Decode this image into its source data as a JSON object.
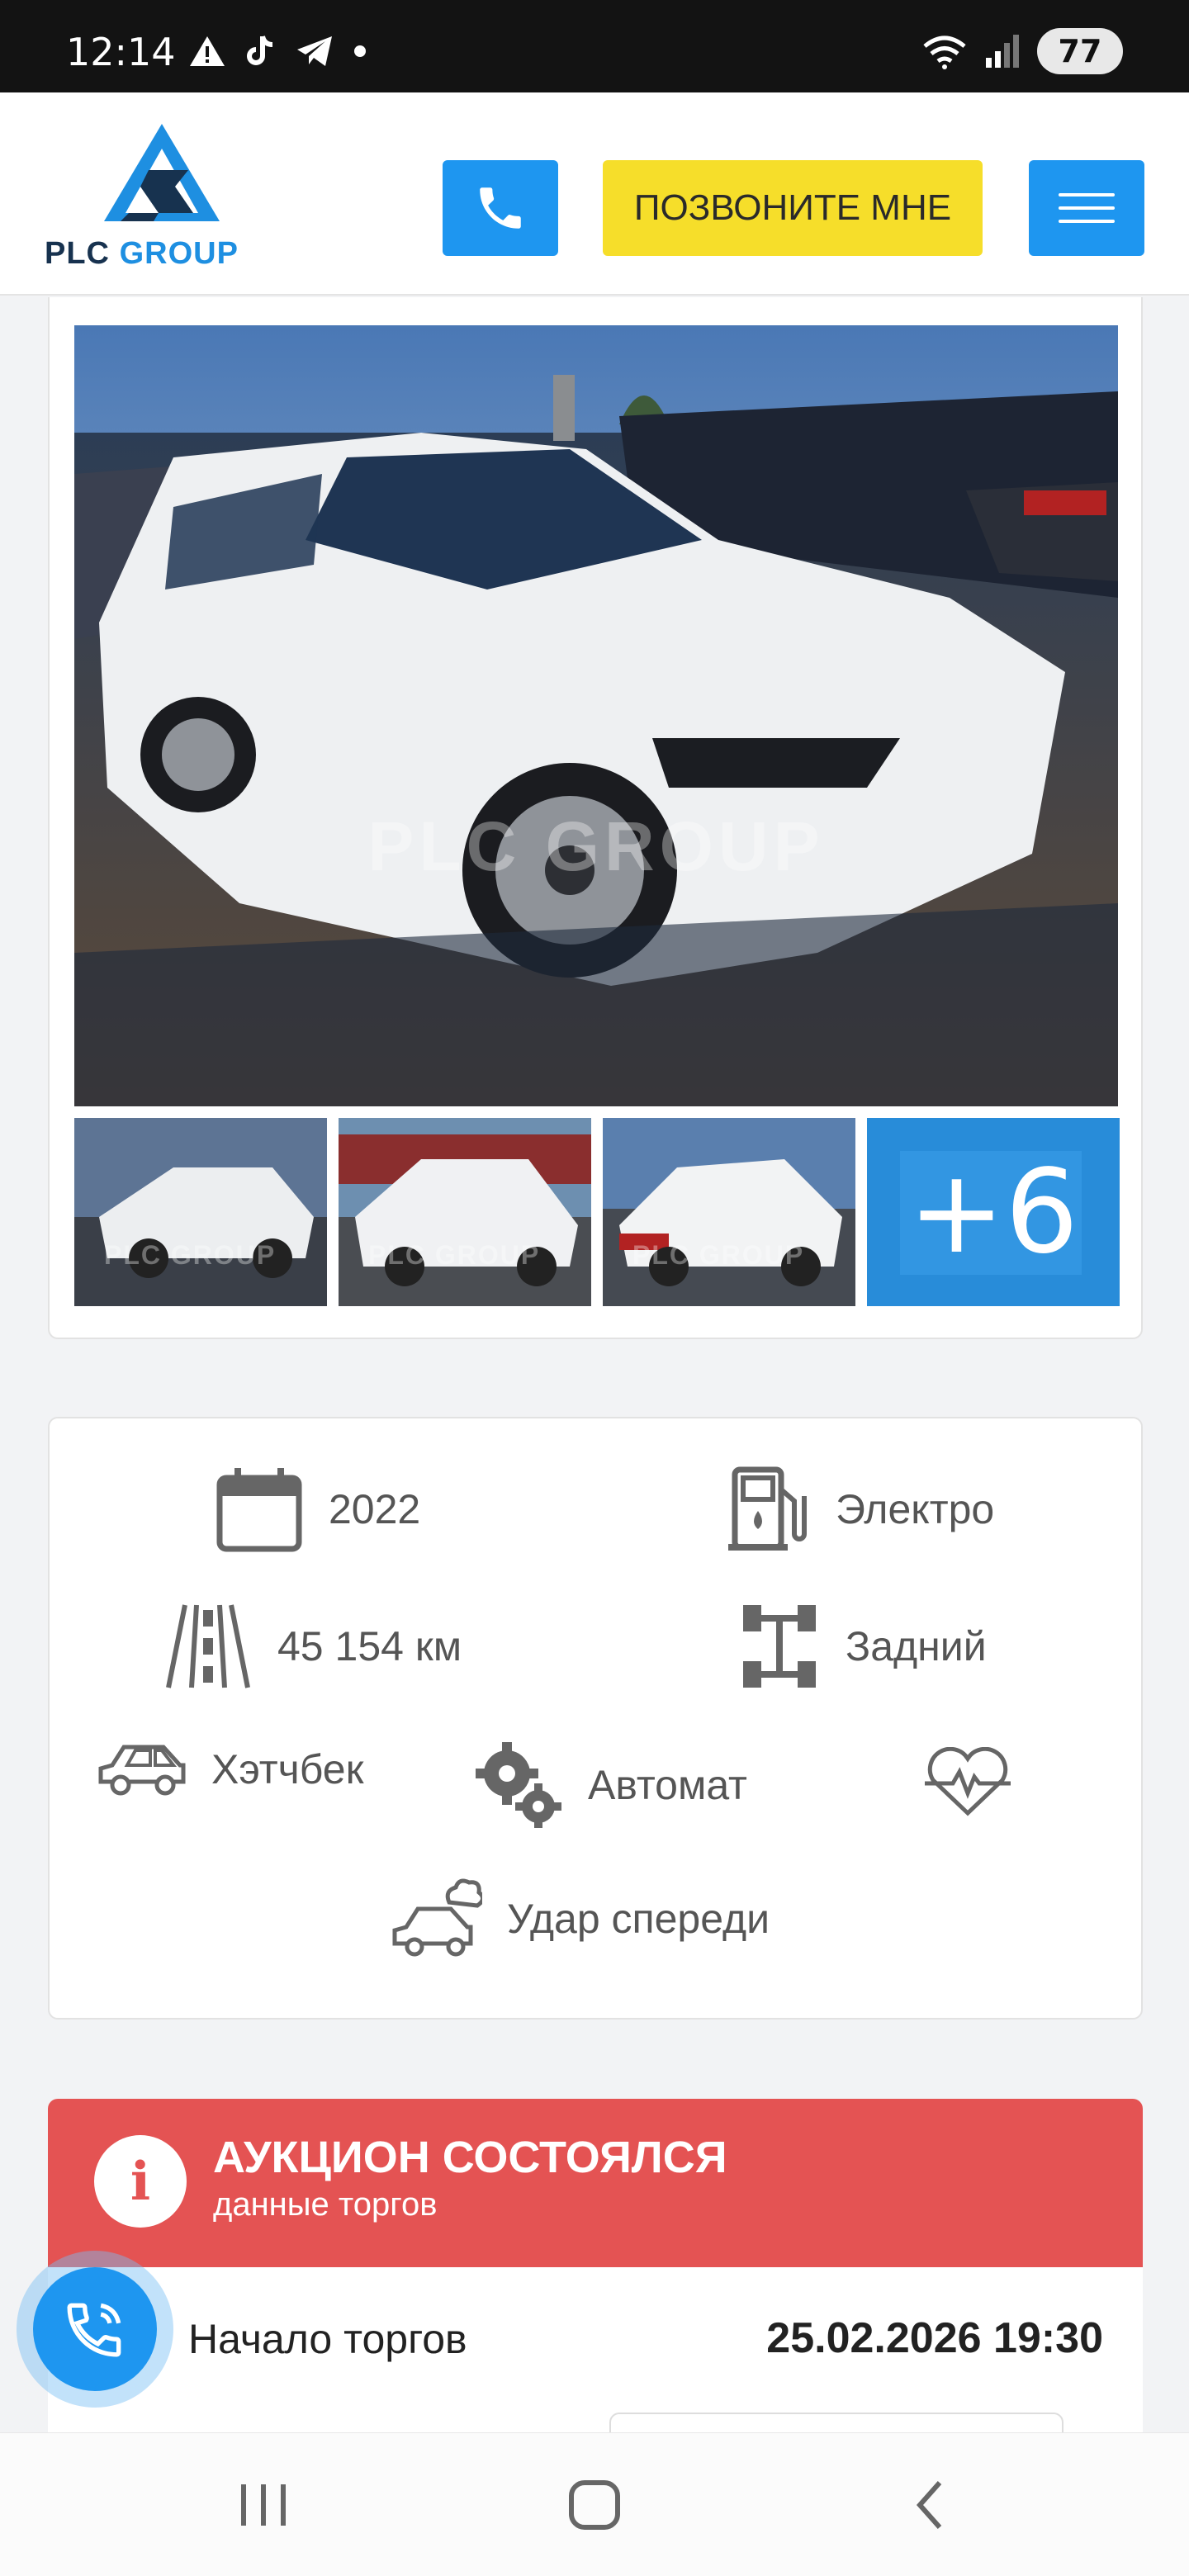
{
  "status_bar": {
    "time": "12:14",
    "battery": "77"
  },
  "header": {
    "logo": {
      "word1": "PLC",
      "word2": "GROUP"
    },
    "phone_button": "phone-icon",
    "callback_button_label": "ПОЗВОНИТЕ МНЕ",
    "menu_button": "hamburger-icon"
  },
  "gallery": {
    "watermark": "PLC GROUP",
    "more_count": "+6"
  },
  "specs": {
    "year": "2022",
    "fuel": "Электро",
    "mileage": "45 154 км",
    "drive": "Задний",
    "body": "Хэтчбек",
    "transmission": "Автомат",
    "damage": "Удар спереди"
  },
  "auction": {
    "title": "АУКЦИОН СОСТОЯЛСЯ",
    "subtitle": "данные торгов",
    "start_label": "Начало торгов",
    "start_value": "25.02.2026 19:30"
  },
  "colors": {
    "accent_blue": "#1e96f0",
    "callback_yellow": "#f6de2a",
    "auction_red": "#e45353"
  }
}
